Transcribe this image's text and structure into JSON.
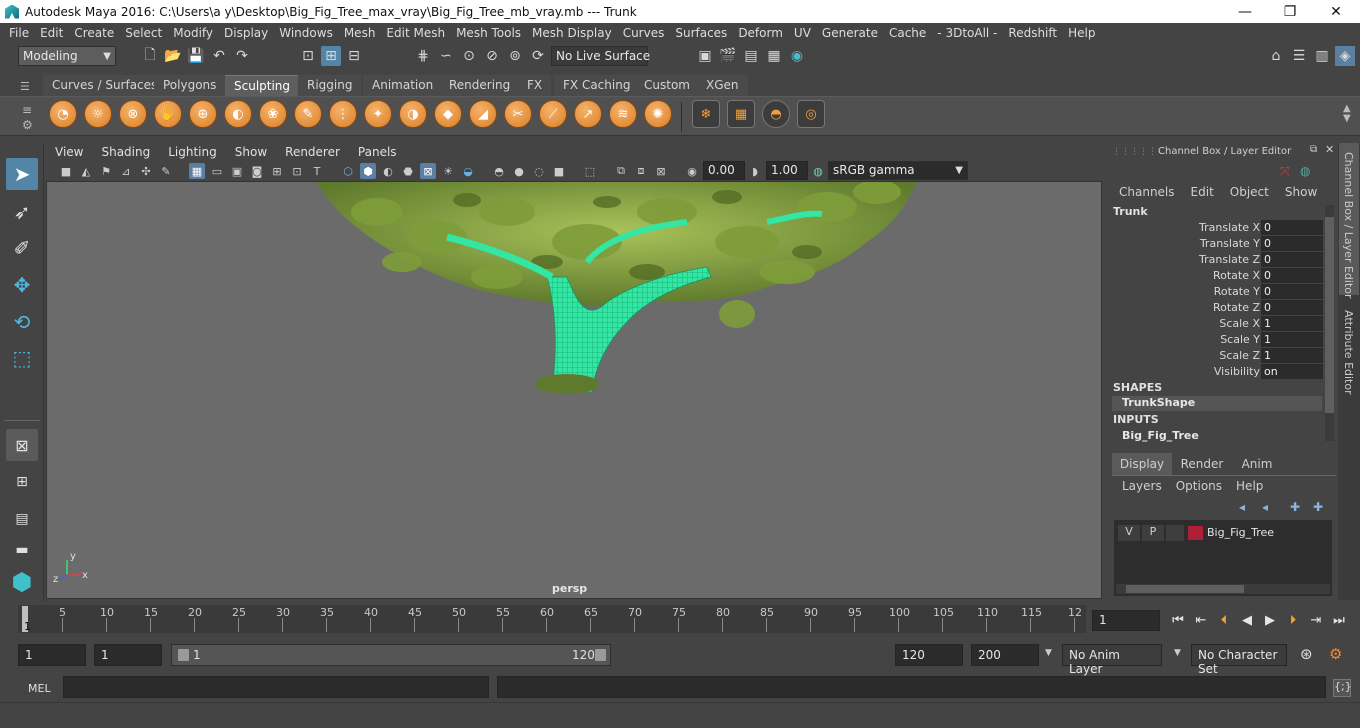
{
  "title_bar": {
    "title": "Autodesk Maya 2016: C:\\Users\\a y\\Desktop\\Big_Fig_Tree_max_vray\\Big_Fig_Tree_mb_vray.mb   ---   Trunk",
    "minimize": "—",
    "maximize": "❐",
    "close": "✕"
  },
  "menu": [
    "File",
    "Edit",
    "Create",
    "Select",
    "Modify",
    "Display",
    "Windows",
    "Mesh",
    "Edit Mesh",
    "Mesh Tools",
    "Mesh Display",
    "Curves",
    "Surfaces",
    "Deform",
    "UV",
    "Generate",
    "Cache",
    "- 3DtoAll -",
    "Redshift",
    "Help"
  ],
  "status_line": {
    "mode": "Modeling",
    "live_surface": "No Live Surface"
  },
  "shelf_tabs": [
    "Curves / Surfaces",
    "Polygons",
    "Sculpting",
    "Rigging",
    "Animation",
    "Rendering",
    "FX",
    "FX Caching",
    "Custom",
    "XGen"
  ],
  "active_shelf_tab": "Sculpting",
  "panel_menu": [
    "View",
    "Shading",
    "Lighting",
    "Show",
    "Renderer",
    "Panels"
  ],
  "panel_toolbar": {
    "exposure": "0.00",
    "gamma": "1.00",
    "color_space": "sRGB gamma"
  },
  "viewport": {
    "camera_label": "persp",
    "axis_y": "y",
    "axis_x": "x",
    "axis_z": "z"
  },
  "channel_box": {
    "header": "Channel Box / Layer Editor",
    "menu": [
      "Channels",
      "Edit",
      "Object",
      "Show"
    ],
    "object_name": "Trunk",
    "channels": [
      {
        "label": "Translate X",
        "value": "0"
      },
      {
        "label": "Translate Y",
        "value": "0"
      },
      {
        "label": "Translate Z",
        "value": "0"
      },
      {
        "label": "Rotate X",
        "value": "0"
      },
      {
        "label": "Rotate Y",
        "value": "0"
      },
      {
        "label": "Rotate Z",
        "value": "0"
      },
      {
        "label": "Scale X",
        "value": "1"
      },
      {
        "label": "Scale Y",
        "value": "1"
      },
      {
        "label": "Scale Z",
        "value": "1"
      },
      {
        "label": "Visibility",
        "value": "on"
      }
    ],
    "shapes_heading": "SHAPES",
    "shape_name": "TrunkShape",
    "inputs_heading": "INPUTS",
    "input_name": "Big_Fig_Tree"
  },
  "layer_editor": {
    "tabs": [
      "Display",
      "Render",
      "Anim"
    ],
    "active_tab": "Display",
    "menu": [
      "Layers",
      "Options",
      "Help"
    ],
    "layers": [
      {
        "v": "V",
        "p": "P",
        "name": "Big_Fig_Tree",
        "color": "#b01f3a"
      }
    ]
  },
  "side_tabs": {
    "channel_box": "Channel Box / Layer Editor",
    "attribute_editor": "Attribute Editor"
  },
  "timeline": {
    "ticks": [
      "5",
      "10",
      "15",
      "20",
      "25",
      "30",
      "35",
      "40",
      "45",
      "50",
      "55",
      "60",
      "65",
      "70",
      "75",
      "80",
      "85",
      "90",
      "95",
      "100",
      "105",
      "110",
      "115",
      "12"
    ],
    "start_mark": "1",
    "current_frame": "1"
  },
  "range": {
    "start": "1",
    "playback_start": "1",
    "slider_start": "1",
    "slider_end": "120",
    "playback_end": "120",
    "end": "200",
    "anim_layer": "No Anim Layer",
    "character_set": "No Character Set"
  },
  "command_line": {
    "label": "MEL"
  },
  "colors": {
    "accent": "#5285a6",
    "sculpt_orange": "#e8953f",
    "layer_red": "#b01f3a"
  }
}
